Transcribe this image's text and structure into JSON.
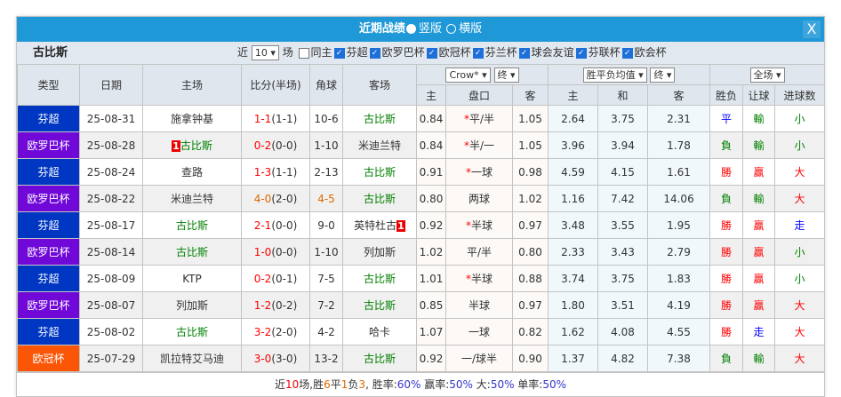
{
  "title": {
    "text": "近期战绩",
    "opt1": "竖版",
    "opt2": "横版",
    "close": "X"
  },
  "filter": {
    "team": "古比斯",
    "prefix": "近",
    "count": "10",
    "suffix": "场",
    "same_home": "同主",
    "leagues": [
      "芬超",
      "欧罗巴杯",
      "欧冠杯",
      "芬兰杯",
      "球会友谊",
      "芬联杯",
      "欧会杯"
    ]
  },
  "headers": {
    "type": "类型",
    "date": "日期",
    "home": "主场",
    "score": "比分(半场)",
    "corner": "角球",
    "away": "客场",
    "company": "Crow*",
    "final1": "终",
    "euro": "胜平负均值",
    "final2": "终",
    "scope": "全场",
    "a_home": "主",
    "a_line": "盘口",
    "a_away": "客",
    "e_home": "主",
    "e_draw": "和",
    "e_away": "客",
    "wl": "胜负",
    "hcp": "让球",
    "goals": "进球数"
  },
  "colors": {
    "芬超": "#0037c2",
    "欧罗巴杯": "#7008d8",
    "欧冠杯": "#fb5606",
    "win": "#ff0000",
    "loss": "#008000",
    "draw": "#0000ff",
    "title_bar": "#1e98d7"
  },
  "rows": [
    {
      "type": "芬超",
      "date": "25-08-31",
      "home": "施拿钟基",
      "score": "1-1",
      "half": "(1-1)",
      "corner": "10-6",
      "away": "古比斯",
      "ah": "0.84",
      "line": "平/半",
      "star": true,
      "aa": "1.05",
      "eh": "2.64",
      "ed": "3.75",
      "ea": "2.31",
      "wl": "平",
      "hcp": "輸",
      "goals": "小"
    },
    {
      "type": "欧罗巴杯",
      "date": "25-08-28",
      "home": "古比斯",
      "home_badge": "1",
      "score": "0-2",
      "half": "(0-0)",
      "corner": "1-10",
      "away": "米迪兰特",
      "ah": "0.84",
      "line": "半/一",
      "star": true,
      "aa": "1.05",
      "eh": "3.96",
      "ed": "3.94",
      "ea": "1.78",
      "wl": "負",
      "hcp": "輸",
      "goals": "小"
    },
    {
      "type": "芬超",
      "date": "25-08-24",
      "home": "查路",
      "score": "1-3",
      "half": "(1-1)",
      "corner": "2-13",
      "away": "古比斯",
      "ah": "0.91",
      "line": "一球",
      "star": true,
      "aa": "0.98",
      "eh": "4.59",
      "ed": "4.15",
      "ea": "1.61",
      "wl": "勝",
      "hcp": "贏",
      "goals": "大"
    },
    {
      "type": "欧罗巴杯",
      "date": "25-08-22",
      "home": "米迪兰特",
      "score": "4-0",
      "half": "(2-0)",
      "corner": "4-5",
      "away": "古比斯",
      "ah": "0.80",
      "line": "两球",
      "star": false,
      "aa": "1.02",
      "eh": "1.16",
      "ed": "7.42",
      "ea": "14.06",
      "wl": "負",
      "hcp": "輸",
      "goals": "大"
    },
    {
      "type": "芬超",
      "date": "25-08-17",
      "home": "古比斯",
      "score": "2-1",
      "half": "(0-0)",
      "corner": "9-0",
      "away": "英特杜古",
      "away_badge": "1",
      "ah": "0.92",
      "line": "半球",
      "star": true,
      "aa": "0.97",
      "eh": "3.48",
      "ed": "3.55",
      "ea": "1.95",
      "wl": "勝",
      "hcp": "贏",
      "goals": "走"
    },
    {
      "type": "欧罗巴杯",
      "date": "25-08-14",
      "home": "古比斯",
      "score": "1-0",
      "half": "(0-0)",
      "corner": "1-10",
      "away": "列加斯",
      "ah": "1.02",
      "line": "平/半",
      "star": false,
      "aa": "0.80",
      "eh": "2.33",
      "ed": "3.43",
      "ea": "2.79",
      "wl": "勝",
      "hcp": "贏",
      "goals": "小"
    },
    {
      "type": "芬超",
      "date": "25-08-09",
      "home": "KTP",
      "score": "0-2",
      "half": "(0-1)",
      "corner": "7-5",
      "away": "古比斯",
      "ah": "1.01",
      "line": "半球",
      "star": true,
      "aa": "0.88",
      "eh": "3.74",
      "ed": "3.75",
      "ea": "1.83",
      "wl": "勝",
      "hcp": "贏",
      "goals": "小"
    },
    {
      "type": "欧罗巴杯",
      "date": "25-08-07",
      "home": "列加斯",
      "score": "1-2",
      "half": "(0-2)",
      "corner": "7-2",
      "away": "古比斯",
      "ah": "0.85",
      "line": "半球",
      "star": false,
      "aa": "0.97",
      "eh": "1.80",
      "ed": "3.51",
      "ea": "4.19",
      "wl": "勝",
      "hcp": "贏",
      "goals": "大"
    },
    {
      "type": "芬超",
      "date": "25-08-02",
      "home": "古比斯",
      "score": "3-2",
      "half": "(2-0)",
      "corner": "4-2",
      "away": "哈卡",
      "ah": "1.07",
      "line": "一球",
      "star": false,
      "aa": "0.82",
      "eh": "1.62",
      "ed": "4.08",
      "ea": "4.55",
      "wl": "勝",
      "hcp": "走",
      "goals": "大"
    },
    {
      "type": "欧冠杯",
      "date": "25-07-29",
      "home": "凯拉特艾马迪",
      "score": "3-0",
      "half": "(3-0)",
      "corner": "13-2",
      "away": "古比斯",
      "ah": "0.92",
      "line": "一/球半",
      "star": false,
      "aa": "0.90",
      "eh": "1.37",
      "ed": "4.82",
      "ea": "7.38",
      "wl": "負",
      "hcp": "輸",
      "goals": "大"
    }
  ],
  "footer": {
    "p1": "近",
    "n": "10",
    "p2": "场,胜",
    "w": "6",
    "p3": "平",
    "d": "1",
    "p4": "负",
    "l": "3",
    "p5": ", 胜率:",
    "wr": "60%",
    "p6": " 赢率:",
    "yr": "50%",
    "p7": " 大:",
    "br": "50%",
    "p8": " 单率:",
    "sr": "50%"
  }
}
